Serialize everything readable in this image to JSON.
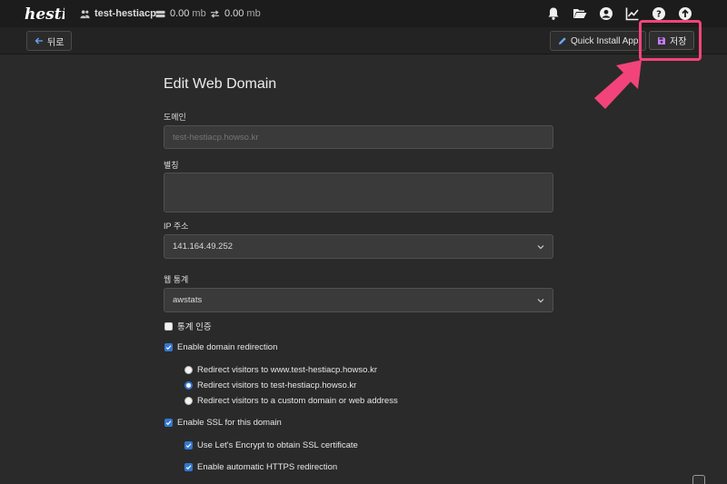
{
  "topbar": {
    "logo_text": "hestia",
    "user": "test-hestiacp",
    "disk": {
      "value": "0.00",
      "unit": "mb"
    },
    "bandwidth": {
      "value": "0.00",
      "unit": "mb"
    },
    "icons": [
      "bell-icon",
      "folder-open-icon",
      "user-circle-icon",
      "chart-line-icon",
      "help-icon",
      "arrow-up-circle-icon"
    ]
  },
  "toolbar": {
    "back_label": "뒤로",
    "quick_install_label": "Quick Install App",
    "save_label": "저장"
  },
  "annotation": {
    "highlight_color": "#f2447a"
  },
  "form": {
    "title": "Edit Web Domain",
    "domain_label": "도메인",
    "domain_placeholder": "test-hestiacp.howso.kr",
    "alias_label": "별칭",
    "ip_label": "IP 주소",
    "ip_value": "141.164.49.252",
    "stats_label": "웹 통계",
    "stats_value": "awstats",
    "stats_auth_label": "통계 인증",
    "stats_auth_checked": false,
    "redirect_label": "Enable domain redirection",
    "redirect_checked": true,
    "redirect_options": [
      {
        "label": "Redirect visitors to www.test-hestiacp.howso.kr",
        "selected": false
      },
      {
        "label": "Redirect visitors to test-hestiacp.howso.kr",
        "selected": true
      },
      {
        "label": "Redirect visitors to a custom domain or web address",
        "selected": false
      }
    ],
    "ssl_label": "Enable SSL for this domain",
    "ssl_checked": true,
    "letsencrypt_label": "Use Let's Encrypt to obtain SSL certificate",
    "letsencrypt_checked": true,
    "https_redirect_label": "Enable automatic HTTPS redirection",
    "https_redirect_checked": true
  },
  "colors": {
    "accent": "#3478d0",
    "background": "#2a2a2a",
    "topbar": "#1c1c1c"
  }
}
